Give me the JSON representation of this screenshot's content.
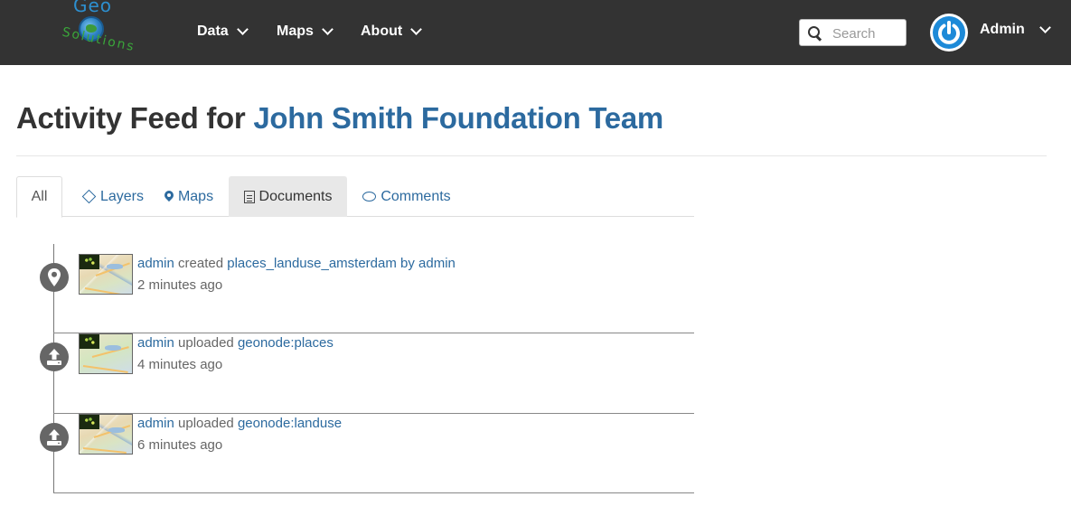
{
  "brand": {
    "logo_word1": "Geo",
    "logo_word2": "Solutions"
  },
  "nav": {
    "items": [
      {
        "label": "Data"
      },
      {
        "label": "Maps"
      },
      {
        "label": "About"
      }
    ]
  },
  "search": {
    "placeholder": "Search",
    "value": ""
  },
  "user": {
    "name": "Admin"
  },
  "page": {
    "title_prefix": "Activity Feed for",
    "team_name": "John Smith Foundation Team"
  },
  "tabs": [
    {
      "label": "All",
      "state": "active"
    },
    {
      "label": "Layers",
      "icon": "diamond-icon"
    },
    {
      "label": "Maps",
      "icon": "map-marker-icon"
    },
    {
      "label": "Documents",
      "icon": "document-icon",
      "state": "hover"
    },
    {
      "label": "Comments",
      "icon": "comment-icon"
    }
  ],
  "activities": [
    {
      "icon": "map-marker-icon",
      "actor": "admin",
      "verb": "created",
      "target": "places_landuse_amsterdam by admin",
      "time": "2 minutes ago"
    },
    {
      "icon": "upload-icon",
      "actor": "admin",
      "verb": "uploaded",
      "target": "geonode:places",
      "time": "4 minutes ago"
    },
    {
      "icon": "upload-icon",
      "actor": "admin",
      "verb": "uploaded",
      "target": "geonode:landuse",
      "time": "6 minutes ago"
    }
  ],
  "colors": {
    "navbar": "#333333",
    "link": "#2c6a9f",
    "avatar": "#1d8ad8",
    "badge": "#666666"
  }
}
